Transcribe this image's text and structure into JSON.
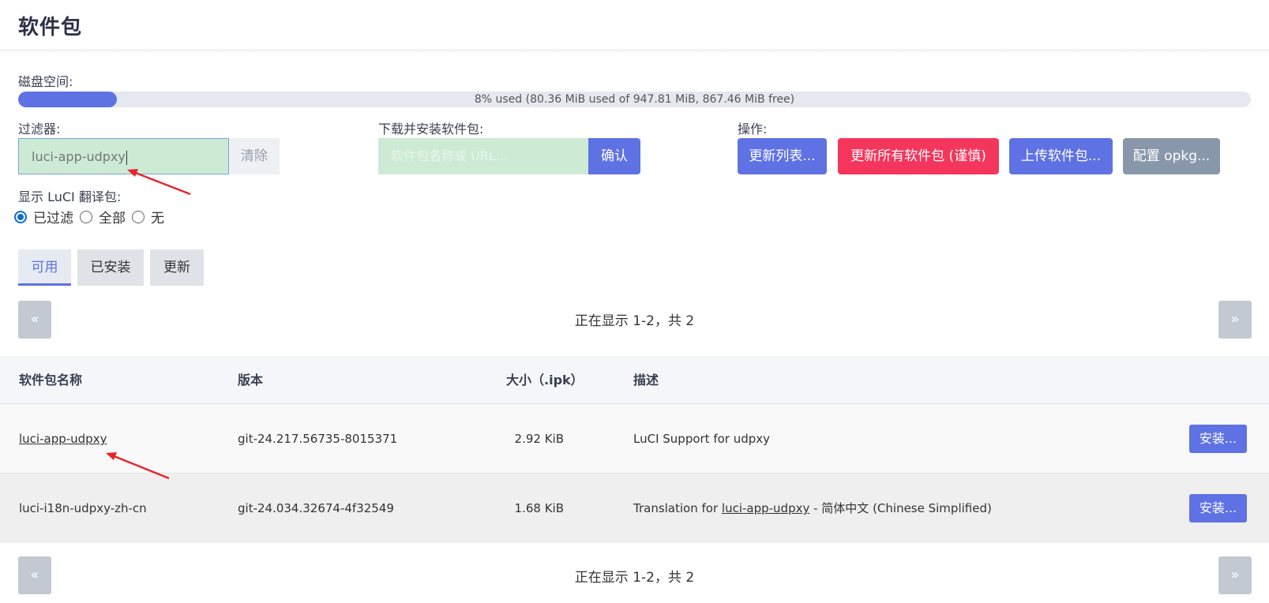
{
  "page": {
    "title": "软件包"
  },
  "disk": {
    "label": "磁盘空间:",
    "used_fraction": 0.08,
    "text": "8% used (80.36 MiB used of 947.81 MiB, 867.46 MiB free)"
  },
  "filter": {
    "label": "过滤器:",
    "value": "luci-app-udpxy",
    "clear_label": "清除"
  },
  "download": {
    "label": "下载并安装软件包:",
    "placeholder": "软件包名称或 URL...",
    "confirm_label": "确认"
  },
  "actions": {
    "label": "操作:",
    "update_lists": "更新列表...",
    "upgrade_all": "更新所有软件包 (谨慎)",
    "upload": "上传软件包...",
    "configure": "配置 opkg..."
  },
  "translations": {
    "label": "显示 LuCI 翻译包:",
    "options": [
      "已过滤",
      "全部",
      "无"
    ],
    "selected": "已过滤"
  },
  "tabs": [
    "可用",
    "已安装",
    "更新"
  ],
  "active_tab": "可用",
  "pager": {
    "prev": "«",
    "next": "»",
    "status": "正在显示 1-2，共 2"
  },
  "table": {
    "headers": [
      "软件包名称",
      "版本",
      "大小（.ipk）",
      "描述"
    ],
    "rows": [
      {
        "name": "luci-app-udpxy",
        "version": "git-24.217.56735-8015371",
        "size": "2.92 KiB",
        "desc": "LuCI Support for udpxy",
        "action": "安装..."
      },
      {
        "name": "luci-i18n-udpxy-zh-cn",
        "version": "git-24.034.32674-4f32549",
        "size": "1.68 KiB",
        "desc_prefix": "Translation for ",
        "desc_link": "luci-app-udpxy",
        "desc_suffix": " - 简体中文 (Chinese Simplified)",
        "action": "安装..."
      }
    ]
  },
  "colors": {
    "accent": "#5e72e4",
    "danger": "#f5365c",
    "neutral": "#8898aa",
    "annotation": "#e8252a"
  }
}
